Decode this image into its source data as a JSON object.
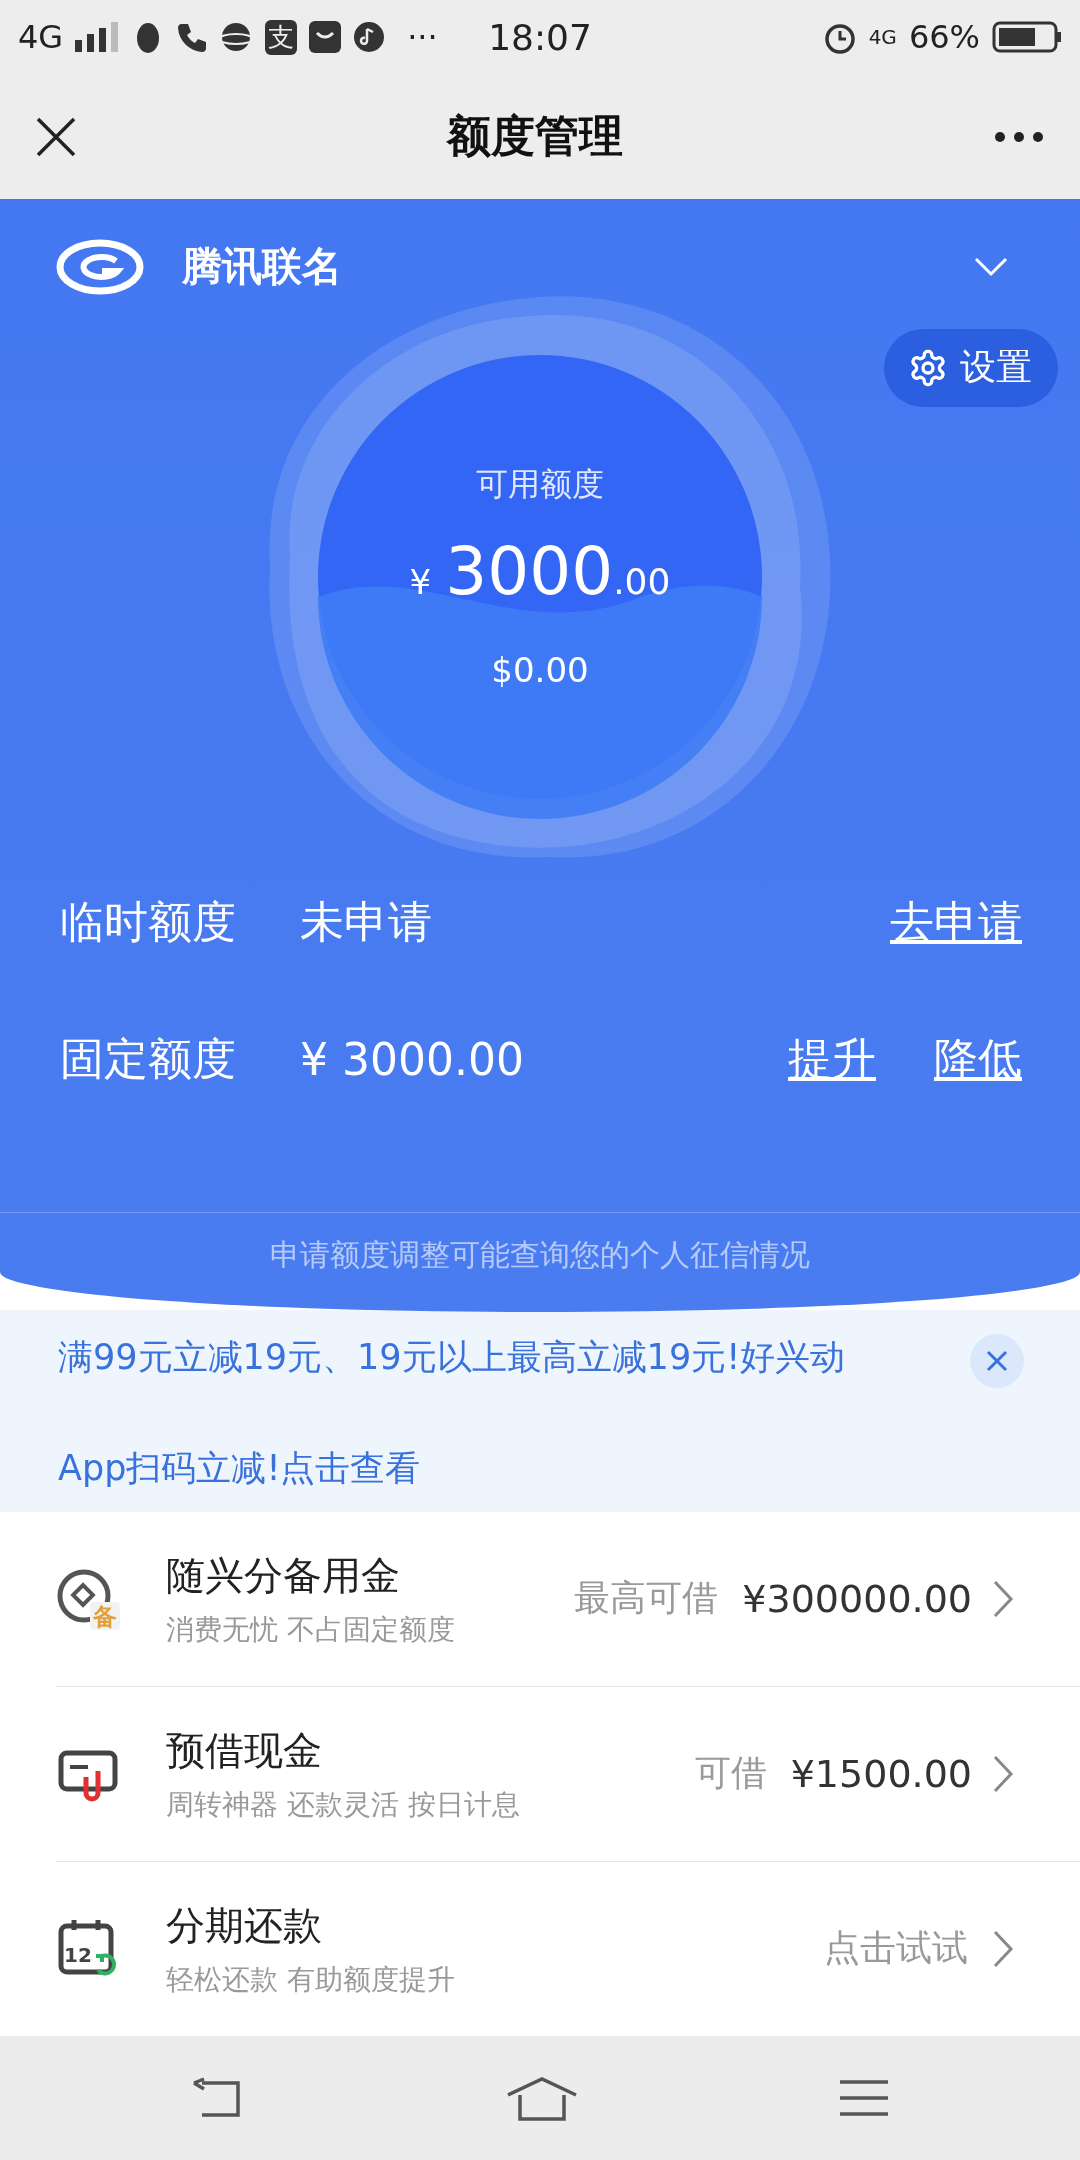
{
  "status_bar": {
    "network": "4G",
    "app_badge": "支",
    "more": "···",
    "time": "18:07",
    "network_right": "4G",
    "battery": "66%"
  },
  "nav": {
    "title": "额度管理"
  },
  "card": {
    "name": "腾讯联名",
    "settings": "设置",
    "available_label": "可用额度",
    "currency": "¥",
    "amount_int": "3000",
    "amount_dec": ".00",
    "usd": "$0.00"
  },
  "limits": [
    {
      "label": "临时额度",
      "value": "未申请",
      "actions": [
        "去申请"
      ]
    },
    {
      "label": "固定额度",
      "value": "¥ 3000.00",
      "actions": [
        "提升",
        "降低"
      ]
    }
  ],
  "note": "申请额度调整可能查询您的个人征信情况",
  "notice": {
    "lines": [
      "满99元立减19元、19元以上最高立减19元!好兴动",
      "App扫码立减!点击查看"
    ]
  },
  "products": [
    {
      "kind": "reserve",
      "icon_text": "备",
      "title": "随兴分备用金",
      "subtitle": "消费无忧 不占固定额度",
      "label": "最高可借",
      "amount": "¥300000.00"
    },
    {
      "kind": "cash",
      "title": "预借现金",
      "subtitle": "周转神器 还款灵活 按日计息",
      "label": "可借",
      "amount": "¥1500.00"
    },
    {
      "kind": "installment",
      "icon_text": "12",
      "title": "分期还款",
      "subtitle": "轻松还款 有助额度提升",
      "label": "点击试试"
    }
  ]
}
